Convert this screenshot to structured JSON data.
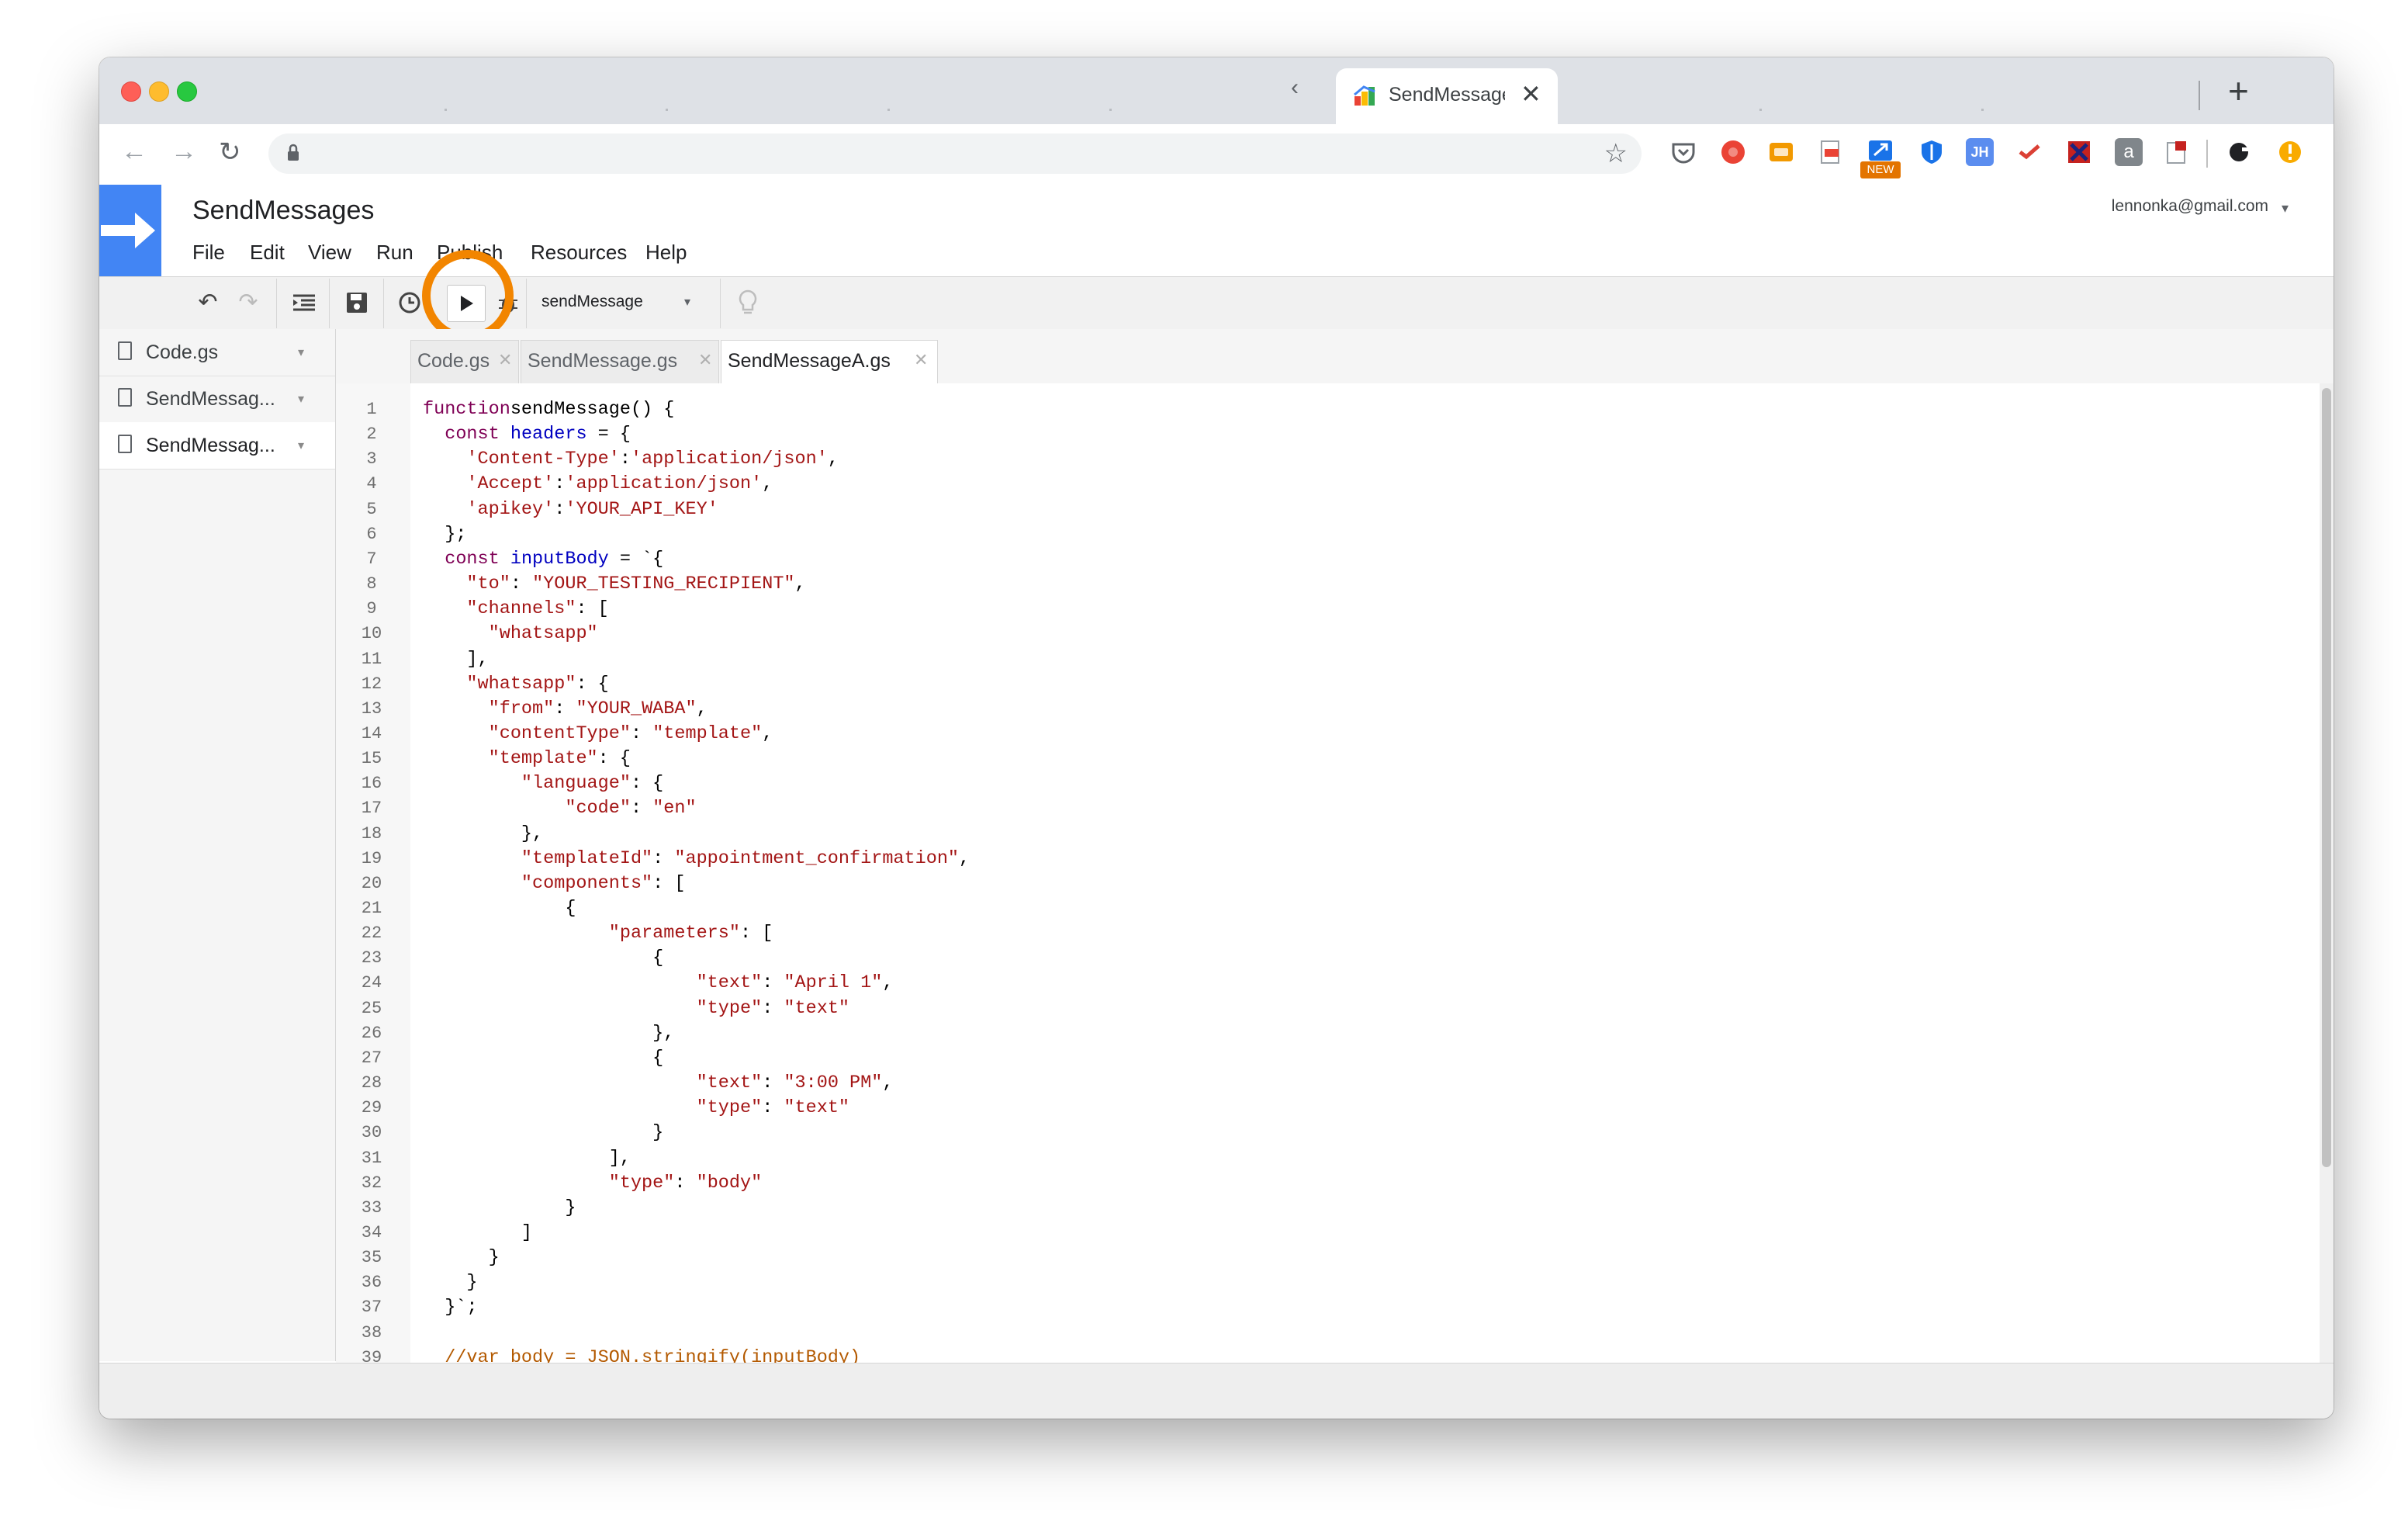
{
  "browser": {
    "tab_title": "SendMessages",
    "new_tab": "+",
    "tab_close": "✕",
    "ext_new_badge": "NEW",
    "ext_jh": "JH",
    "ext_a": "a"
  },
  "app": {
    "project_title": "SendMessages",
    "account": "lennonka@gmail.com",
    "menu": [
      "File",
      "Edit",
      "View",
      "Run",
      "Publish",
      "Resources",
      "Help"
    ],
    "selected_function": "sendMessage",
    "brand_color": "#4285f4",
    "highlight_color": "#f28500"
  },
  "sidebar": {
    "files": [
      "Code.gs",
      "SendMessag...",
      "SendMessag..."
    ]
  },
  "editor_tabs": [
    "Code.gs",
    "SendMessage.gs",
    "SendMessageA.gs"
  ],
  "line_numbers": [
    "1",
    "2",
    "3",
    "4",
    "5",
    "6",
    "7",
    "8",
    "9",
    "10",
    "11",
    "12",
    "13",
    "14",
    "15",
    "16",
    "17",
    "18",
    "19",
    "20",
    "21",
    "22",
    "23",
    "24",
    "25",
    "26",
    "27",
    "28",
    "29",
    "30",
    "31",
    "32",
    "33",
    "34",
    "35",
    "36",
    "37",
    "38",
    "39"
  ],
  "code": [
    [
      [
        "kw",
        "function"
      ],
      [
        "",
        "sendMessage() {"
      ]
    ],
    [
      [
        "",
        "  "
      ],
      [
        "kw",
        "const"
      ],
      [
        "",
        ""
      ],
      [
        "var",
        " headers"
      ],
      [
        "",
        " = {"
      ]
    ],
    [
      [
        "",
        "    "
      ],
      [
        "str",
        "'Content-Type'"
      ],
      [
        "",
        ":"
      ],
      [
        "str",
        "'application/json'"
      ],
      [
        "",
        ","
      ]
    ],
    [
      [
        "",
        "    "
      ],
      [
        "str",
        "'Accept'"
      ],
      [
        "",
        ":"
      ],
      [
        "str",
        "'application/json'"
      ],
      [
        "",
        ","
      ]
    ],
    [
      [
        "",
        "    "
      ],
      [
        "str",
        "'apikey'"
      ],
      [
        "",
        ":"
      ],
      [
        "str",
        "'YOUR_API_KEY'"
      ]
    ],
    [
      [
        "",
        "  };"
      ]
    ],
    [
      [
        "",
        "  "
      ],
      [
        "kw",
        "const"
      ],
      [
        "var",
        " inputBody"
      ],
      [
        "",
        " = `{"
      ]
    ],
    [
      [
        "",
        "    "
      ],
      [
        "str",
        "\"to\""
      ],
      [
        "",
        ": "
      ],
      [
        "str",
        "\"YOUR_TESTING_RECIPIENT\""
      ],
      [
        "",
        ","
      ]
    ],
    [
      [
        "",
        "    "
      ],
      [
        "str",
        "\"channels\""
      ],
      [
        "",
        ": ["
      ]
    ],
    [
      [
        "",
        "      "
      ],
      [
        "str",
        "\"whatsapp\""
      ]
    ],
    [
      [
        "",
        "    ],"
      ]
    ],
    [
      [
        "",
        "    "
      ],
      [
        "str",
        "\"whatsapp\""
      ],
      [
        "",
        ": {"
      ]
    ],
    [
      [
        "",
        "      "
      ],
      [
        "str",
        "\"from\""
      ],
      [
        "",
        ": "
      ],
      [
        "str",
        "\"YOUR_WABA\""
      ],
      [
        "",
        ","
      ]
    ],
    [
      [
        "",
        "      "
      ],
      [
        "str",
        "\"contentType\""
      ],
      [
        "",
        ": "
      ],
      [
        "str",
        "\"template\""
      ],
      [
        "",
        ","
      ]
    ],
    [
      [
        "",
        "      "
      ],
      [
        "str",
        "\"template\""
      ],
      [
        "",
        ": {"
      ]
    ],
    [
      [
        "",
        "         "
      ],
      [
        "str",
        "\"language\""
      ],
      [
        "",
        ": {"
      ]
    ],
    [
      [
        "",
        "             "
      ],
      [
        "str",
        "\"code\""
      ],
      [
        "",
        ": "
      ],
      [
        "str",
        "\"en\""
      ]
    ],
    [
      [
        "",
        "         },"
      ]
    ],
    [
      [
        "",
        "         "
      ],
      [
        "str",
        "\"templateId\""
      ],
      [
        "",
        ": "
      ],
      [
        "str",
        "\"appointment_confirmation\""
      ],
      [
        "",
        ","
      ]
    ],
    [
      [
        "",
        "         "
      ],
      [
        "str",
        "\"components\""
      ],
      [
        "",
        ": ["
      ]
    ],
    [
      [
        "",
        "             {"
      ]
    ],
    [
      [
        "",
        "                 "
      ],
      [
        "str",
        "\"parameters\""
      ],
      [
        "",
        ": ["
      ]
    ],
    [
      [
        "",
        "                     {"
      ]
    ],
    [
      [
        "",
        "                         "
      ],
      [
        "str",
        "\"text\""
      ],
      [
        "",
        ": "
      ],
      [
        "str",
        "\"April 1\""
      ],
      [
        "",
        ","
      ]
    ],
    [
      [
        "",
        "                         "
      ],
      [
        "str",
        "\"type\""
      ],
      [
        "",
        ": "
      ],
      [
        "str",
        "\"text\""
      ]
    ],
    [
      [
        "",
        "                     },"
      ]
    ],
    [
      [
        "",
        "                     {"
      ]
    ],
    [
      [
        "",
        "                         "
      ],
      [
        "str",
        "\"text\""
      ],
      [
        "",
        ": "
      ],
      [
        "str",
        "\"3:00 PM\""
      ],
      [
        "",
        ","
      ]
    ],
    [
      [
        "",
        "                         "
      ],
      [
        "str",
        "\"type\""
      ],
      [
        "",
        ": "
      ],
      [
        "str",
        "\"text\""
      ]
    ],
    [
      [
        "",
        "                     }"
      ]
    ],
    [
      [
        "",
        "                 ],"
      ]
    ],
    [
      [
        "",
        "                 "
      ],
      [
        "str",
        "\"type\""
      ],
      [
        "",
        ": "
      ],
      [
        "str",
        "\"body\""
      ]
    ],
    [
      [
        "",
        "             }"
      ]
    ],
    [
      [
        "",
        "         ]"
      ]
    ],
    [
      [
        "",
        "      }"
      ]
    ],
    [
      [
        "",
        "    }"
      ]
    ],
    [
      [
        "",
        "  }`;"
      ]
    ],
    [
      [
        "",
        ""
      ]
    ],
    [
      [
        "",
        "  "
      ],
      [
        "cmt",
        "//var body = JSON.stringify(inputBody)"
      ]
    ]
  ]
}
